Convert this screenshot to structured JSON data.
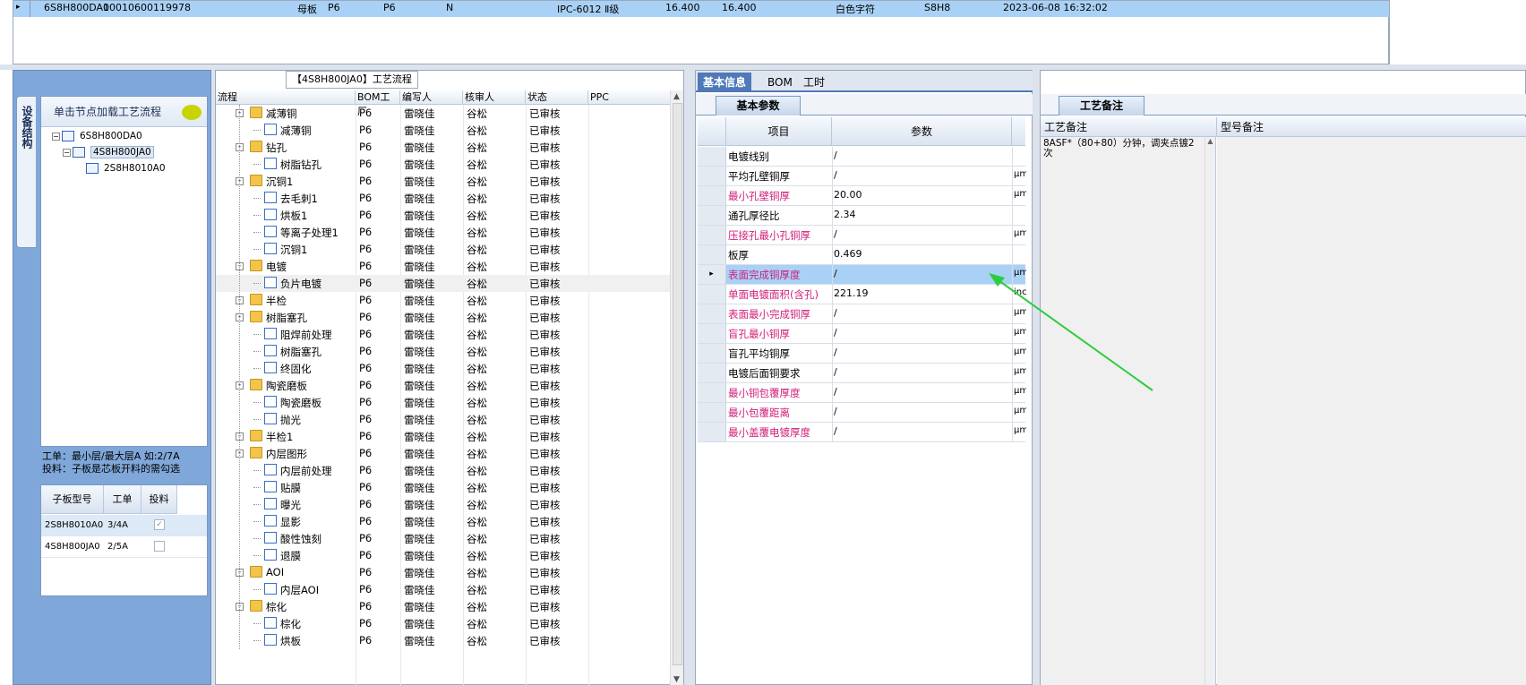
{
  "top_grid": {
    "row_marker": "▸",
    "cells": [
      "6S8H800DA0",
      "10010600119978",
      "母板",
      "P6",
      "P6",
      "N",
      "IPC-6012 Ⅱ级",
      "16.400",
      "16.400",
      "白色字符",
      "S8H8",
      "2023-06-08 16:32:02"
    ]
  },
  "left": {
    "vertical_tab": "设备结构",
    "tree_header": "单击节点加载工艺流程",
    "tree_nodes": [
      "6S8H800DA0",
      "4S8H800JA0",
      "2S8H8010A0"
    ],
    "desc_line1": "工单：最小层/最大层A 如:2/7A",
    "desc_line2": "投料：子板是芯板开料的需勾选",
    "sub_grid": {
      "headers": [
        "子板型号",
        "工单",
        "投料"
      ],
      "rows": [
        {
          "model": "2S8H8010A0",
          "order": "3/4A",
          "checked": "✓"
        },
        {
          "model": "4S8H800JA0",
          "order": "2/5A",
          "checked": ""
        }
      ]
    }
  },
  "flow": {
    "title": "【4S8H800JA0】工艺流程",
    "headers": [
      "流程",
      "BOM工厂",
      "编写人",
      "核审人",
      "状态",
      "PPC"
    ],
    "factory": "P6",
    "writer": "雷晓佳",
    "reviewer": "谷松",
    "status": "已审核",
    "rows": [
      {
        "name": "减薄铜",
        "level": 0
      },
      {
        "name": "减薄铜",
        "level": 1
      },
      {
        "name": "钻孔",
        "level": 0
      },
      {
        "name": "树脂钻孔",
        "level": 1
      },
      {
        "name": "沉铜1",
        "level": 0
      },
      {
        "name": "去毛刺1",
        "level": 1
      },
      {
        "name": "烘板1",
        "level": 1
      },
      {
        "name": "等离子处理1",
        "level": 1
      },
      {
        "name": "沉铜1",
        "level": 1
      },
      {
        "name": "电镀",
        "level": 0
      },
      {
        "name": "负片电镀",
        "level": 1
      },
      {
        "name": "半检",
        "level": 0
      },
      {
        "name": "树脂塞孔",
        "level": 0
      },
      {
        "name": "阻焊前处理",
        "level": 1
      },
      {
        "name": "树脂塞孔",
        "level": 1
      },
      {
        "name": "终固化",
        "level": 1
      },
      {
        "name": "陶瓷磨板",
        "level": 0
      },
      {
        "name": "陶瓷磨板",
        "level": 1
      },
      {
        "name": "抛光",
        "level": 1
      },
      {
        "name": "半检1",
        "level": 0
      },
      {
        "name": "内层图形",
        "level": 0
      },
      {
        "name": "内层前处理",
        "level": 1
      },
      {
        "name": "贴膜",
        "level": 1
      },
      {
        "name": "曝光",
        "level": 1
      },
      {
        "name": "显影",
        "level": 1
      },
      {
        "name": "酸性蚀刻",
        "level": 1
      },
      {
        "name": "退膜",
        "level": 1
      },
      {
        "name": "AOI",
        "level": 0
      },
      {
        "name": "内层AOI",
        "level": 1
      },
      {
        "name": "棕化",
        "level": 0
      },
      {
        "name": "棕化",
        "level": 1
      },
      {
        "name": "烘板",
        "level": 1
      }
    ]
  },
  "info": {
    "tabs": [
      "基本信息",
      "BOM",
      "工时"
    ],
    "sub_tab": "基本参数",
    "headers": [
      "项目",
      "参数"
    ],
    "params": [
      {
        "k": "电镀线别",
        "v": "/",
        "u": "",
        "pink": false
      },
      {
        "k": "平均孔壁铜厚",
        "v": "/",
        "u": "μm",
        "pink": false
      },
      {
        "k": "最小孔壁铜厚",
        "v": "20.00",
        "u": "μm",
        "pink": true
      },
      {
        "k": "通孔厚径比",
        "v": "2.34",
        "u": "",
        "pink": false
      },
      {
        "k": "压接孔最小孔铜厚",
        "v": "/",
        "u": "μm",
        "pink": true
      },
      {
        "k": "板厚",
        "v": "0.469",
        "u": "",
        "pink": false
      },
      {
        "k": "表面完成铜厚度",
        "v": "/",
        "u": "μm",
        "pink": true
      },
      {
        "k": "单面电镀面积(含孔)",
        "v": "221.19",
        "u": "inch",
        "pink": true
      },
      {
        "k": "表面最小完成铜厚",
        "v": "/",
        "u": "μm",
        "pink": true
      },
      {
        "k": "盲孔最小铜厚",
        "v": "/",
        "u": "μm",
        "pink": true
      },
      {
        "k": "盲孔平均铜厚",
        "v": "/",
        "u": "μm",
        "pink": false
      },
      {
        "k": "电镀后面铜要求",
        "v": "/",
        "u": "μm",
        "pink": false
      },
      {
        "k": "最小铜包覆厚度",
        "v": "/",
        "u": "μm",
        "pink": true
      },
      {
        "k": "最小包覆距离",
        "v": "/",
        "u": "μm",
        "pink": true
      },
      {
        "k": "最小盖覆电镀厚度",
        "v": "/",
        "u": "μm",
        "pink": true
      }
    ],
    "selected_row_marker": "▸"
  },
  "remarks": {
    "tab": "工艺备注",
    "headers": [
      "工艺备注",
      "型号备注"
    ],
    "text": "8ASF*（80+80）分钟，调夹点镀2次"
  },
  "colors": {
    "selection": "#a9d1f5",
    "pink": "#d0207a",
    "arrow": "#2ecc40"
  }
}
